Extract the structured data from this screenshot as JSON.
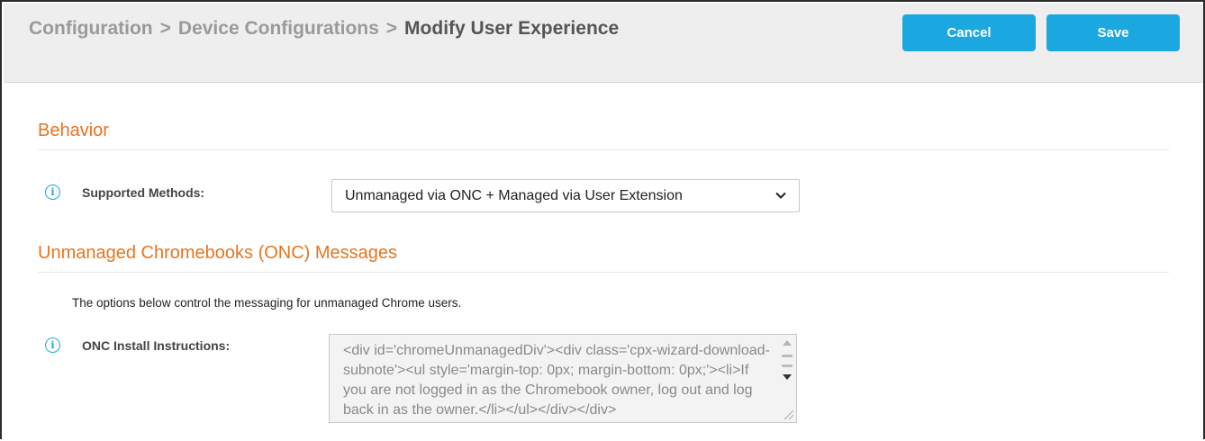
{
  "header": {
    "breadcrumb": [
      {
        "label": "Configuration"
      },
      {
        "label": "Device Configurations"
      },
      {
        "label": "Modify User Experience"
      }
    ],
    "separator": ">",
    "cancel_label": "Cancel",
    "save_label": "Save"
  },
  "behavior": {
    "title": "Behavior",
    "supported_methods_label": "Supported Methods:",
    "supported_methods_value": "Unmanaged via ONC + Managed via User Extension"
  },
  "onc": {
    "title": "Unmanaged Chromebooks (ONC) Messages",
    "help_text": "The options below control the messaging for unmanaged Chrome users.",
    "install_instructions_label": "ONC Install Instructions:",
    "install_instructions_value": "<div id='chromeUnmanagedDiv'><div class='cpx-wizard-download-subnote'><ul style='margin-top: 0px; margin-bottom: 0px;'><li>If you are not logged in as the Chromebook owner, log out and log back in as the owner.</li></ul></div></div>"
  },
  "icons": {
    "info": "i"
  },
  "colors": {
    "accent": "#1ba8e0",
    "section_title": "#e8731d",
    "header_bg": "#eeeeee"
  }
}
